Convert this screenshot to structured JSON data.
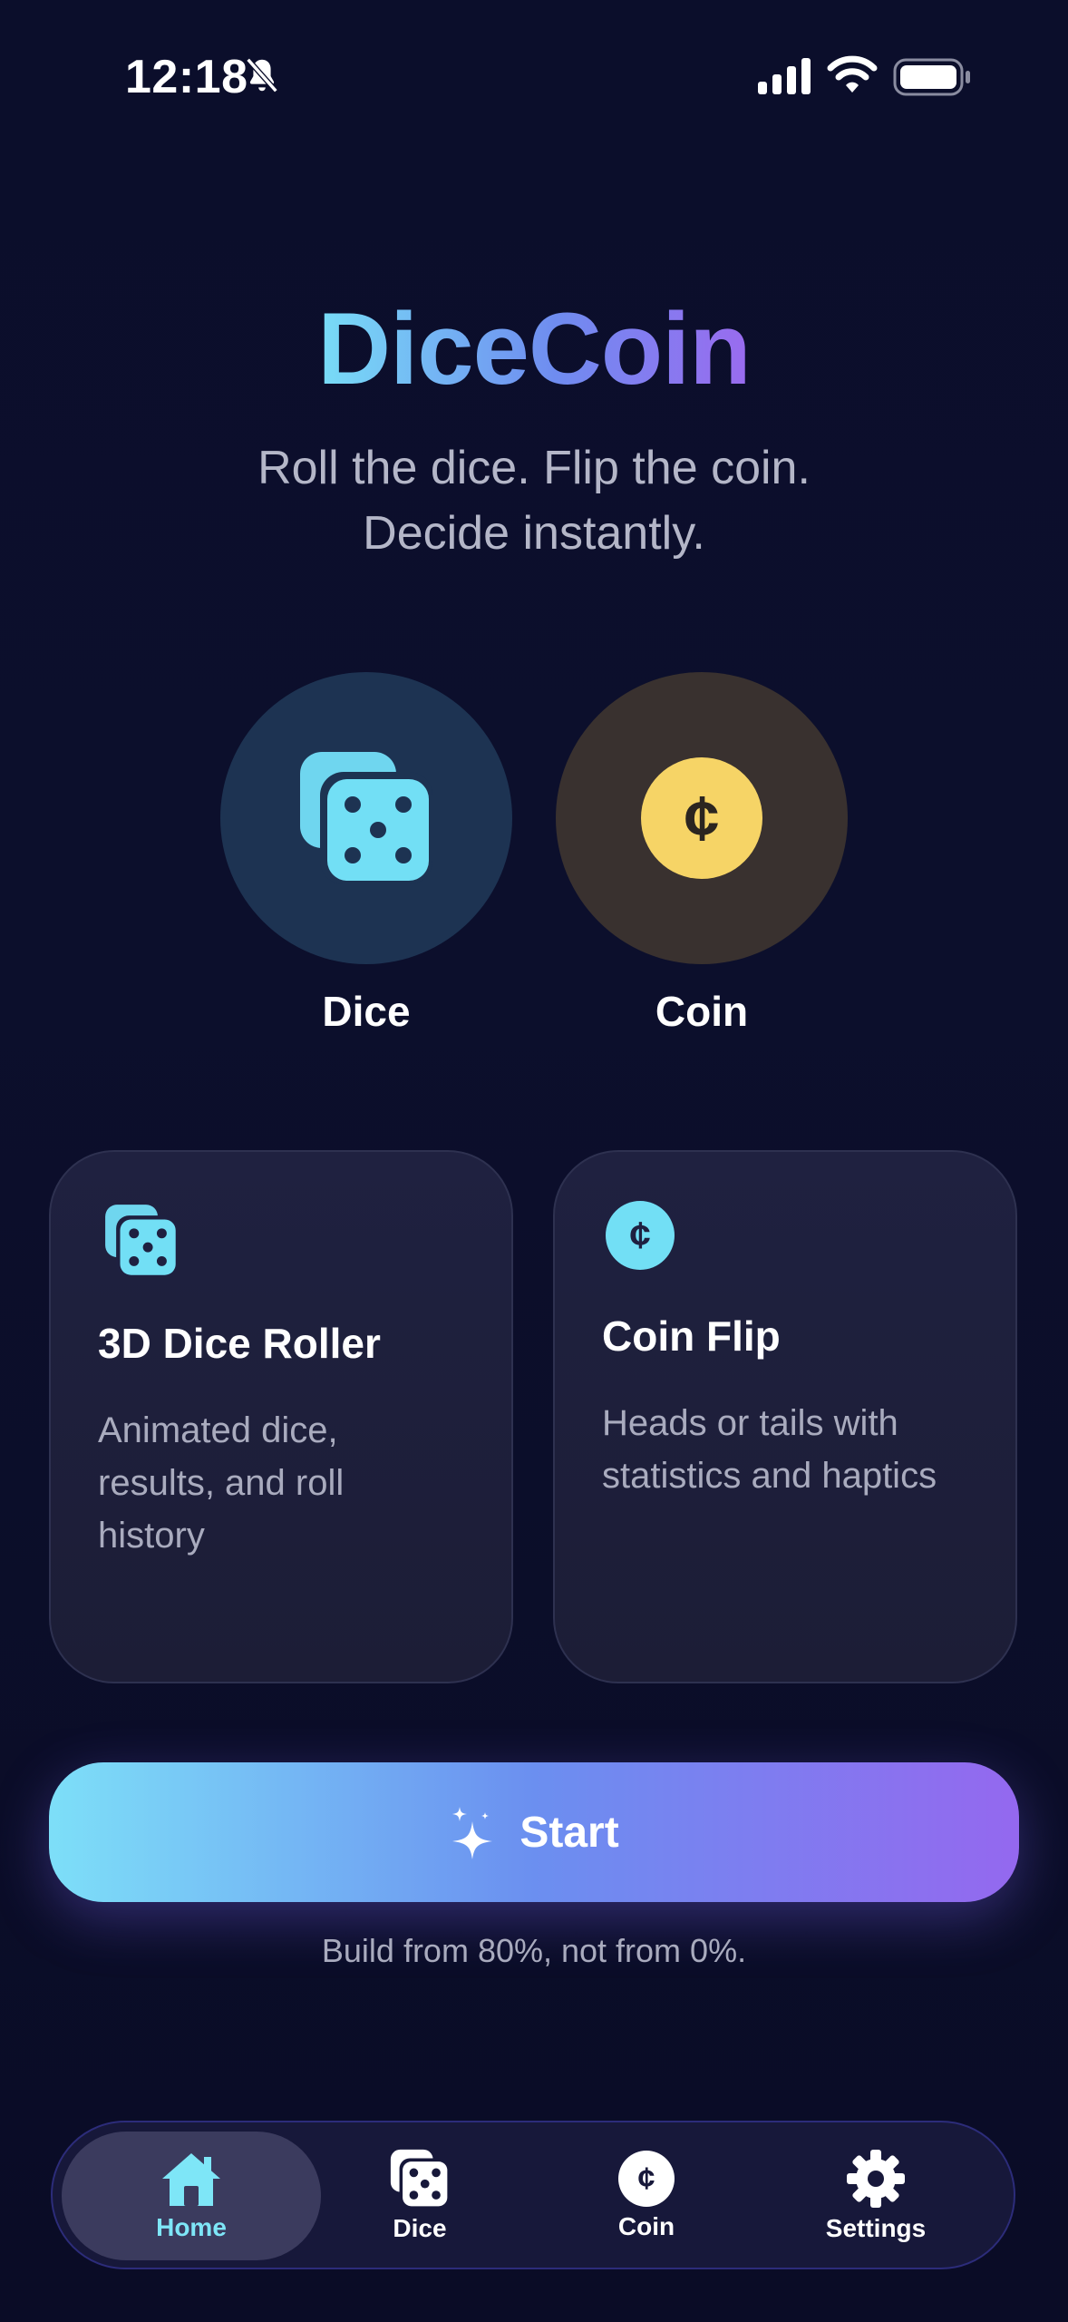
{
  "status_bar": {
    "time": "12:18"
  },
  "header": {
    "title": "DiceCoin",
    "subtitle_line1": "Roll the dice. Flip the coin.",
    "subtitle_line2": "Decide instantly."
  },
  "modes": [
    {
      "label": "Dice",
      "icon": "dice-icon"
    },
    {
      "label": "Coin",
      "icon": "coin-icon",
      "glyph": "¢"
    }
  ],
  "cards": [
    {
      "title": "3D Dice Roller",
      "desc_lines": [
        "Animated dice,",
        "results, and roll",
        "history"
      ],
      "icon": "dice-icon"
    },
    {
      "title": "Coin Flip",
      "desc_lines": [
        "Heads or tails with",
        "statistics and haptics"
      ],
      "icon": "coin-icon",
      "glyph": "¢"
    }
  ],
  "start_button": {
    "label": "Start",
    "icon": "sparkles-icon"
  },
  "tagline": "Build from 80%, not from 0%.",
  "tabbar": {
    "items": [
      {
        "label": "Home",
        "icon": "home-icon",
        "active": true
      },
      {
        "label": "Dice",
        "icon": "dice-icon",
        "active": false
      },
      {
        "label": "Coin",
        "icon": "coin-icon",
        "glyph": "¢",
        "active": false
      },
      {
        "label": "Settings",
        "icon": "gear-icon",
        "active": false
      }
    ]
  },
  "colors": {
    "background": "#0b0e2b",
    "accent_cyan": "#78ddf7",
    "accent_purple": "#9468ef",
    "coin_yellow": "#f6d466",
    "dice_circle": "#1d3352",
    "coin_circle": "#39312f"
  }
}
